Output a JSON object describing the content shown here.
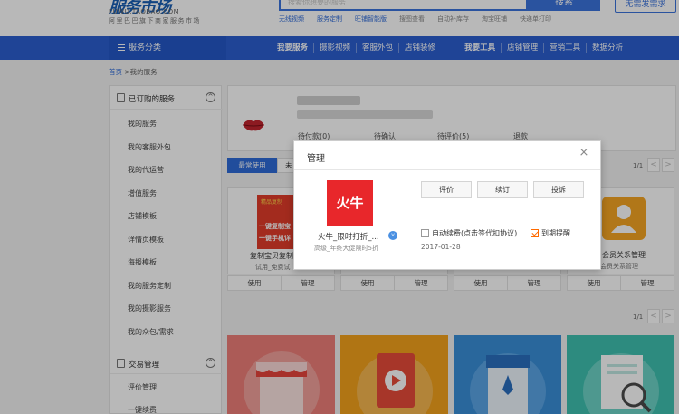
{
  "header": {
    "logo_text": "服务市场",
    "logo_url": "FUWU.TAOBAO.COM",
    "slogan": "阿里巴巴旗下商家服务市场",
    "search_placeholder": "搜索你想要的服务",
    "search_button": "搜索",
    "publish_button": "无需发需求",
    "quick_links": [
      {
        "label": "无线视频",
        "style": "blue"
      },
      {
        "label": "服务定制",
        "style": "blue"
      },
      {
        "label": "旺铺智能版",
        "style": "blue"
      },
      {
        "label": "搜图查看",
        "style": "gray"
      },
      {
        "label": "自动补库存",
        "style": "gray"
      },
      {
        "label": "淘宝旺铺",
        "style": "gray"
      },
      {
        "label": "快递单打印",
        "style": "gray"
      }
    ]
  },
  "nav": {
    "category": "服务分类",
    "items": [
      "我要服务",
      "摄影视频",
      "客服外包",
      "店铺装修",
      "我要工具",
      "店铺管理",
      "营销工具",
      "数据分析"
    ]
  },
  "breadcrumb": {
    "home": "首页",
    "current": ">我的服务"
  },
  "sidebar": {
    "section1": "已订购的服务",
    "section1_toggle": "^",
    "items": [
      "我的服务",
      "我的客服外包",
      "我的代运营",
      "增值服务",
      "店铺模板",
      "详情页模板",
      "海报模板",
      "我的服务定制",
      "我的摄影服务",
      "我的众包/需求"
    ],
    "section2": "交易管理",
    "section2_toggle": "^",
    "items2": [
      "评价管理",
      "一键续费"
    ]
  },
  "summary": {
    "stats": [
      "待付款(0)",
      "待确认",
      "待评价(5)",
      "退款"
    ]
  },
  "tabs": {
    "active": "最常使用",
    "second": "未"
  },
  "pager": {
    "label": "1/1",
    "prev": "<",
    "next": ">"
  },
  "cards": [
    {
      "name": "复制宝贝复制",
      "sub": "试用_免费试",
      "badge": "精品复制",
      "lines": [
        "一键复制宝",
        "一键手机详"
      ],
      "use": "使用",
      "manage": "管理"
    },
    {
      "name": "",
      "sub": "",
      "use": "使用",
      "manage": "管理"
    },
    {
      "name": "",
      "sub": "",
      "use": "使用",
      "manage": "管理"
    },
    {
      "name": "会员关系管理",
      "sub": "会员关系管理",
      "use": "使用",
      "manage": "管理"
    }
  ],
  "modal": {
    "title": "管理",
    "close": "×",
    "app_icon_text": "火牛",
    "app_name": "火牛_限时打折_...",
    "app_sub": "高级_年终大促限时5折",
    "buttons": [
      "评价",
      "续订",
      "投诉"
    ],
    "auto_renew_label": "自动续费(点击签代扣协议)",
    "auto_renew_checked": false,
    "expire_reminder_label": "到期提醒",
    "expire_reminder_checked": true,
    "expire_date": "2017-01-28"
  },
  "colors": {
    "primary": "#2b5fd0",
    "accent": "#ff6a00",
    "app_red": "#e8272b"
  }
}
